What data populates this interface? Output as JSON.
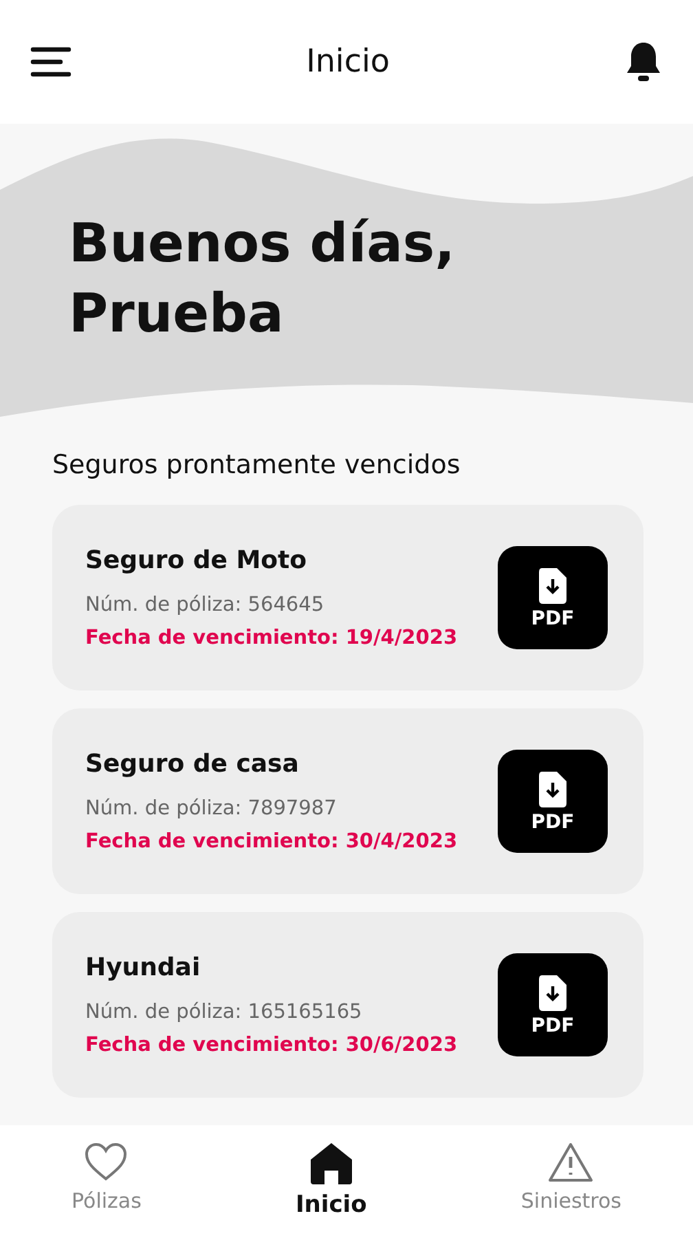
{
  "header": {
    "title": "Inicio"
  },
  "greeting": {
    "line_1": "Buenos días,",
    "line_2": "Prueba"
  },
  "section_title": "Seguros prontamente vencidos",
  "policies": [
    {
      "name": "Seguro de Moto",
      "number": "Núm. de póliza: 564645",
      "expiry": "Fecha de vencimiento: 19/4/2023",
      "button": "PDF"
    },
    {
      "name": "Seguro de casa",
      "number": "Núm. de póliza: 7897987",
      "expiry": "Fecha de vencimiento: 30/4/2023",
      "button": "PDF"
    },
    {
      "name": "Hyundai",
      "number": "Núm. de póliza: 165165165",
      "expiry": "Fecha de vencimiento: 30/6/2023",
      "button": "PDF"
    }
  ],
  "bottom_nav": [
    {
      "label": "Pólizas",
      "selected": false
    },
    {
      "label": "Inicio",
      "selected": true
    },
    {
      "label": "Siniestros",
      "selected": false
    }
  ]
}
